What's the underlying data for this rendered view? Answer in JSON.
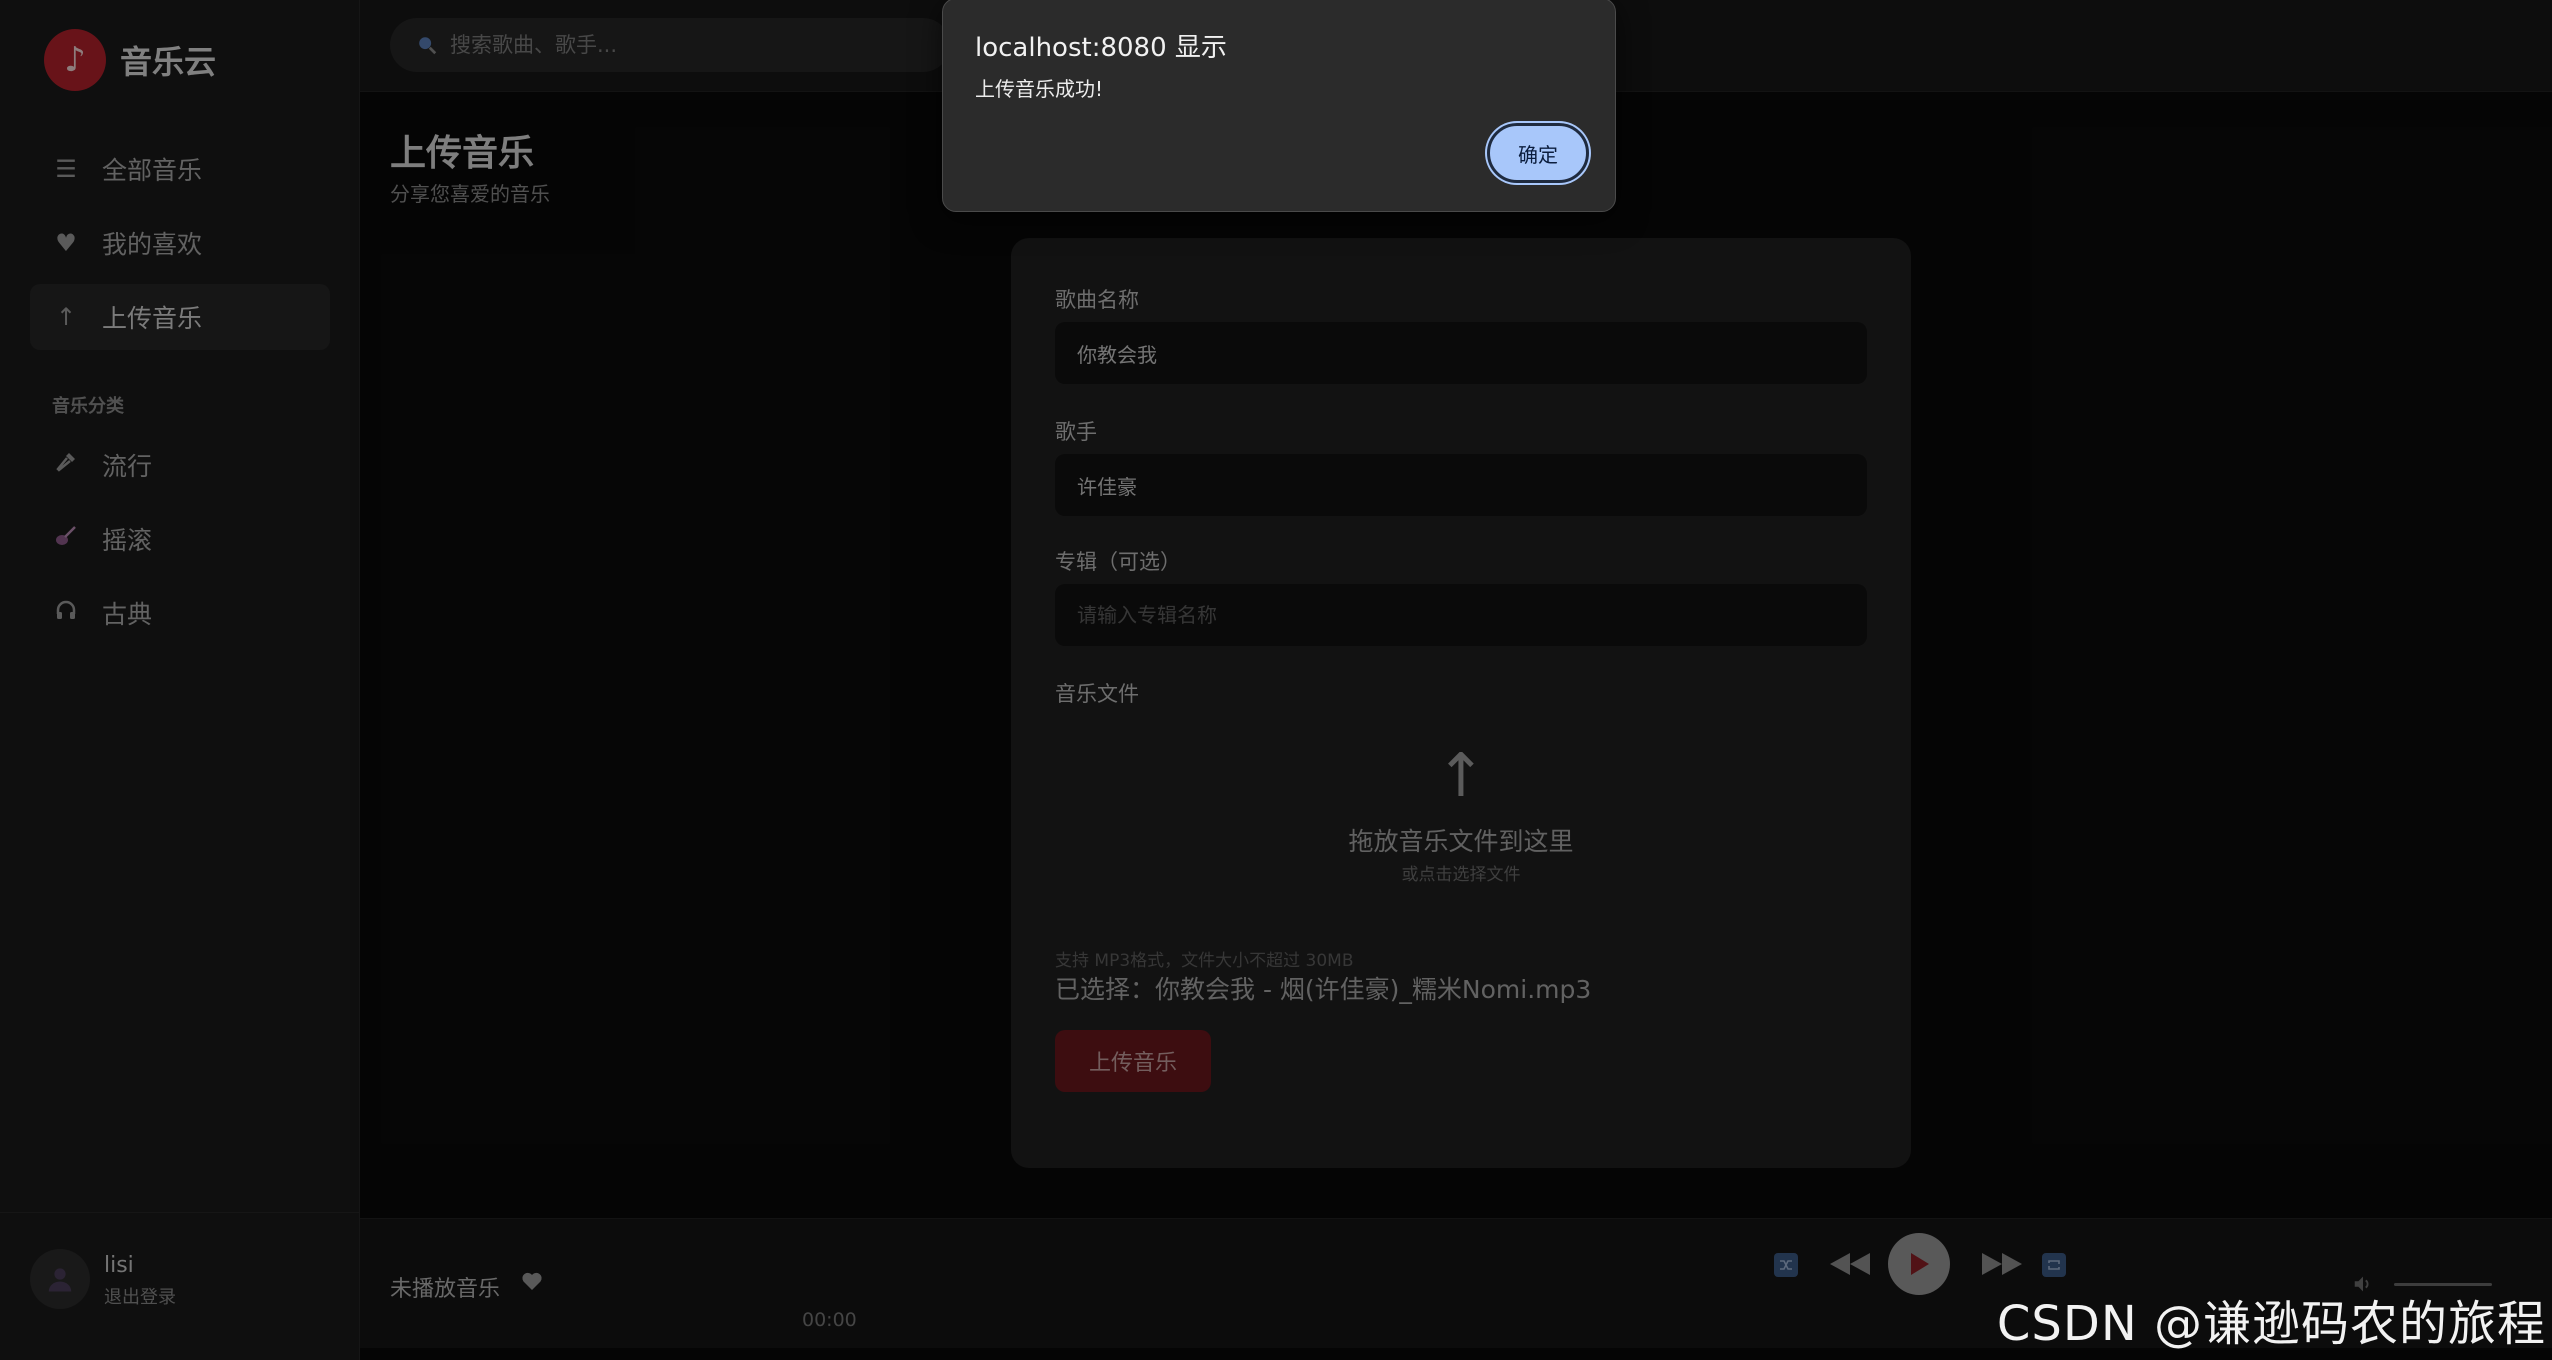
{
  "app": {
    "name": "音乐云",
    "logo_glyph": "♪",
    "brand_color": "#b3212c"
  },
  "sidebar": {
    "nav": [
      {
        "label": "全部音乐",
        "icon": "list-icon"
      },
      {
        "label": "我的喜欢",
        "icon": "heart-icon"
      },
      {
        "label": "上传音乐",
        "icon": "upload-arrow-icon",
        "active": true
      }
    ],
    "section_title": "音乐分类",
    "categories": [
      {
        "label": "流行",
        "icon": "microphone-icon"
      },
      {
        "label": "摇滚",
        "icon": "guitar-icon"
      },
      {
        "label": "古典",
        "icon": "headphones-icon"
      }
    ],
    "user": {
      "name": "lisi",
      "logout": "退出登录"
    }
  },
  "topbar": {
    "search_placeholder": "搜索歌曲、歌手..."
  },
  "page": {
    "title": "上传音乐",
    "subtitle": "分享您喜爱的音乐"
  },
  "form": {
    "song_label": "歌曲名称",
    "song_value": "你教会我",
    "artist_label": "歌手",
    "artist_value": "许佳豪",
    "album_label": "专辑（可选）",
    "album_placeholder": "请输入专辑名称",
    "file_label": "音乐文件",
    "drop_arrow": "↑",
    "drop_title": "拖放音乐文件到这里",
    "drop_subtitle": "或点击选择文件",
    "hint": "支持 MP3格式，文件大小不超过 30MB",
    "selected": "已选择：你教会我 - 烟(许佳豪)_糯米Nomi.mp3",
    "submit": "上传音乐"
  },
  "player": {
    "now_playing": "未播放音乐",
    "time": "00:00",
    "accent": "#3c5a86"
  },
  "dialog": {
    "title": "localhost:8080 显示",
    "message": "上传音乐成功!",
    "ok": "确定",
    "button_color": "#a8c7fa"
  },
  "watermark": "CSDN @谦逊码农的旅程"
}
